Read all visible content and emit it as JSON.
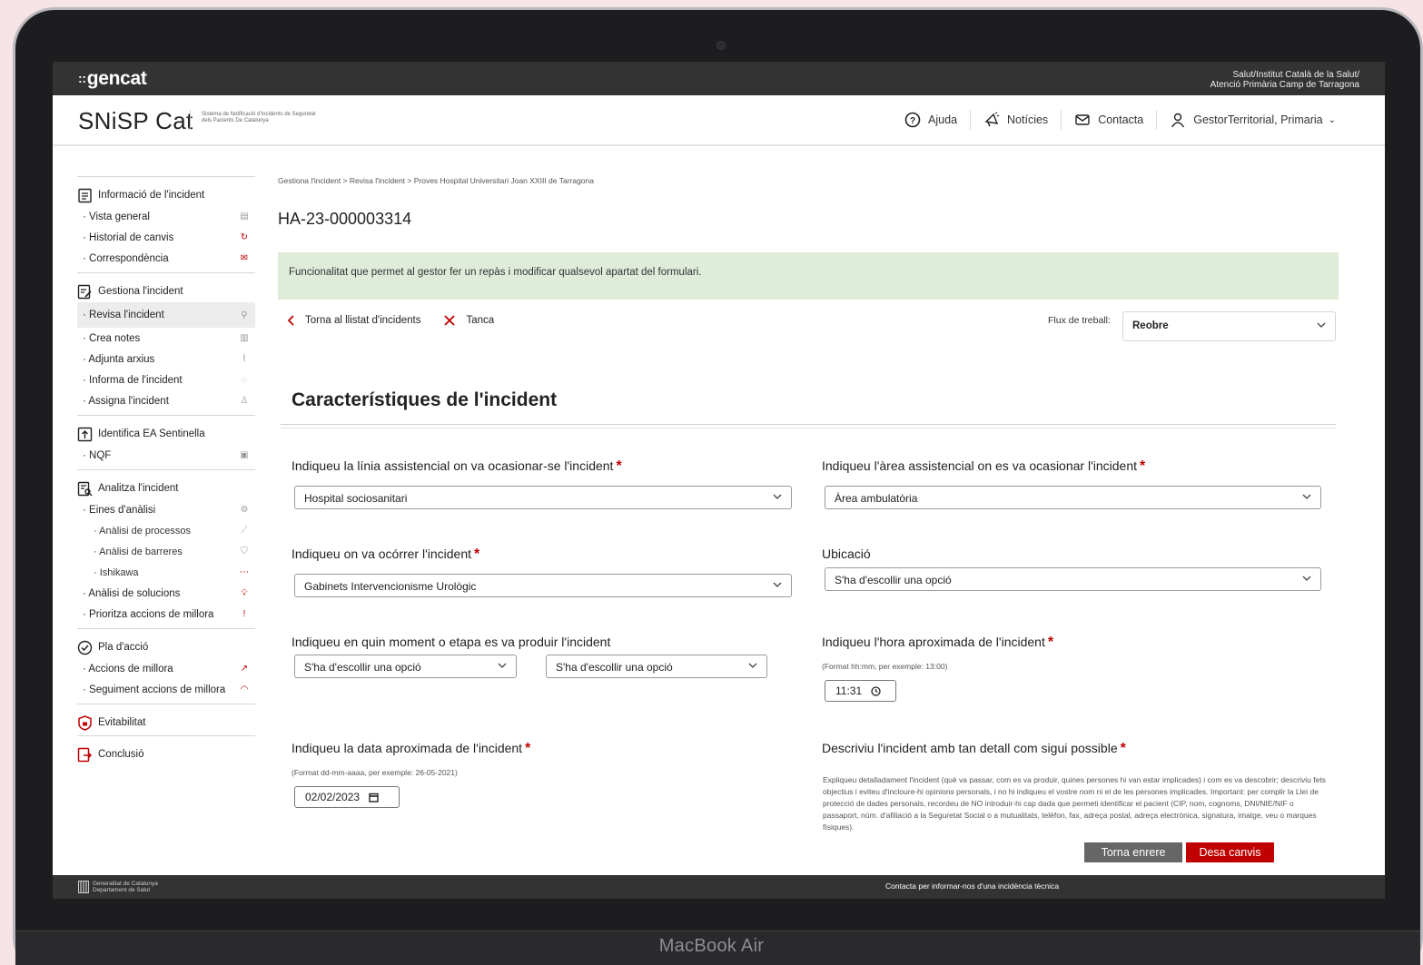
{
  "device": {
    "label": "MacBook Air"
  },
  "topbar": {
    "logo": "gencat",
    "logo_prefix": "::",
    "org_line1": "Salut/Institut Català de la Salut/",
    "org_line2": "Atenció Primària Camp de Tarragona"
  },
  "header": {
    "app_title": "SNiSP Cat",
    "app_subtitle_line1": "Sistema de Notificació d'Incidents de Seguretat",
    "app_subtitle_line2": "dels Pacients De Catalunya",
    "nav": {
      "help": "Ajuda",
      "news": "Notícies",
      "contact": "Contacta",
      "user": "GestorTerritorial, Primaria"
    }
  },
  "sidebar": {
    "info_title": "Informació de l'incident",
    "info_items": [
      "Vista general",
      "Historial de canvis",
      "Correspondència"
    ],
    "manage_title": "Gestiona l'incident",
    "manage_items": [
      "Revisa l'incident",
      "Crea notes",
      "Adjunta arxius",
      "Informa de l'incident",
      "Assigna l'incident"
    ],
    "sentinel_title": "Identifica EA Sentinella",
    "sentinel_items": [
      "NQF"
    ],
    "analyze_title": "Analitza l'incident",
    "analyze_items": [
      "Eines d'anàlisi",
      "Anàlisi de processos",
      "Anàlisi de barreres",
      "Ishikawa",
      "Anàlisi de solucions",
      "Prioritza accions de millora"
    ],
    "plan_title": "Pla d'acció",
    "plan_items": [
      "Accions de millora",
      "Seguiment accions de millora"
    ],
    "avoid_title": "Evitabilitat",
    "conclusion_title": "Conclusió",
    "accent_color": "#c00000"
  },
  "main": {
    "breadcrumb": "Gestiona l'incident > Revisa l'incident > Proves Hospital Universitari Joan XXIII de Tarragona",
    "incident_id": "HA-23-000003314",
    "info_message": "Funcionalitat que permet al gestor fer un repàs i modificar qualsevol apartat del formulari.",
    "back_link": "Torna al llistat d'incidents",
    "close_link": "Tanca",
    "workflow_label": "Flux de treball:",
    "workflow_value": "Reobre",
    "section_title": "Característiques de l'incident",
    "fields": {
      "line_label": "Indiqueu la línia assistencial on va ocasionar-se l'incident",
      "line_value": "Hospital sociosanitari",
      "area_label": "Indiqueu l'àrea assistencial on es va ocasionar l'incident",
      "area_value": "Àrea ambulatòria",
      "where_label": "Indiqueu on va ocórrer l'incident",
      "where_value": "Gabinets Intervencionisme Urològic",
      "location_label": "Ubicació",
      "location_value": "S'ha d'escollir una opció",
      "moment_label": "Indiqueu en quin moment o etapa es va produir l'incident",
      "moment_value1": "S'ha d'escollir una opció",
      "moment_value2": "S'ha d'escollir una opció",
      "hour_label": "Indiqueu l'hora aproximada de l'incident",
      "hour_hint": "(Format hh:mm, per exemple: 13:00)",
      "hour_value": "11:31",
      "date_label": "Indiqueu la data aproximada de l'incident",
      "date_hint": "(Format dd-mm-aaaa, per exemple: 26-05-2021)",
      "date_value": "02/02/2023",
      "desc_label": "Descriviu l'incident amb tan detall com sigui possible",
      "desc_text": "Expliqueu detalladament l'incident (què va passar, com es va produir, quines persones hi van estar implicades) i com es va descobrir; descriviu fets objectius i eviteu d'incloure-hi opinions personals, i no hi indiqueu el vostre nom ni el de les persones implicades. Important: per complir la Llei de protecció de dades personals, recordeu de NO introduir-hi cap dada que permeti identificar el pacient (CIP, nom, cognoms, DNI/NIE/NIF o passaport, núm. d'afiliació a la Seguretat Social o a mutualitats, telèfon, fax, adreça postal, adreça electrònica, signatura, imatge, veu o marques físiques)."
    },
    "buttons": {
      "back": "Torna enrere",
      "save": "Desa canvis"
    }
  },
  "footer": {
    "gov_line1": "Generalitat de Catalunya",
    "gov_line2": "Departament de Salut",
    "contact": "Contacta per informar-nos d'una incidència tècnica"
  }
}
